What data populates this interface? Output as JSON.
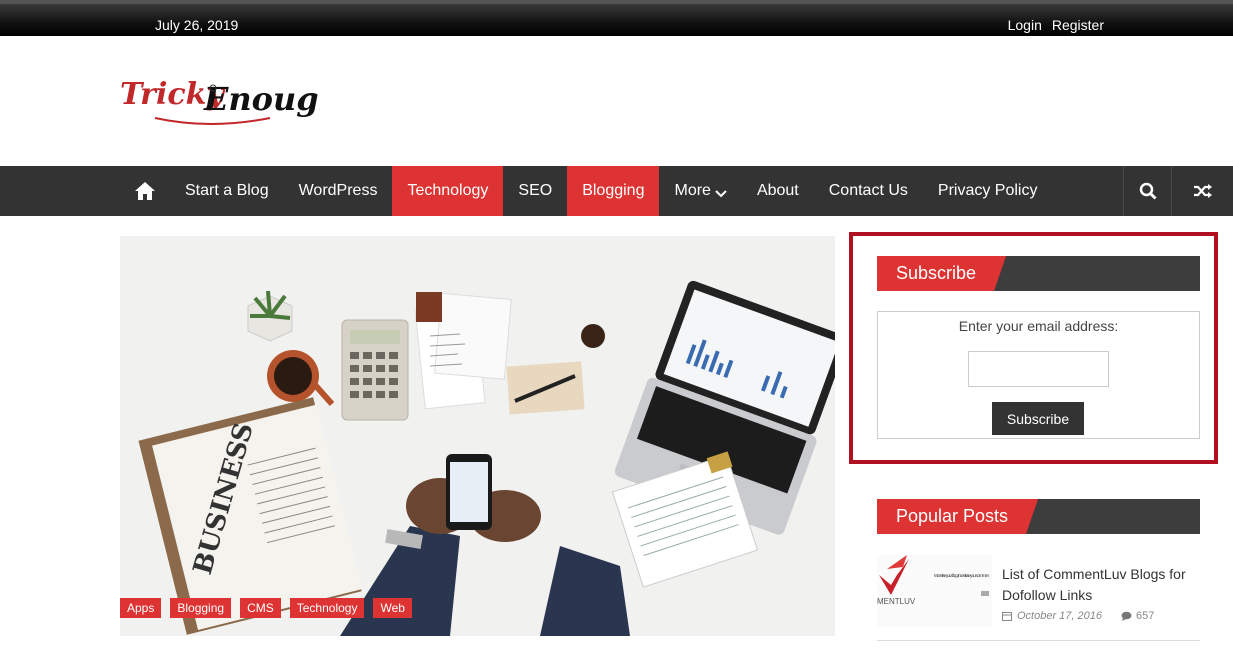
{
  "topbar": {
    "date": "July 26, 2019",
    "login": "Login",
    "register": "Register"
  },
  "logo": {
    "part1": "Tricky",
    "part2": "Enough"
  },
  "nav": {
    "items": [
      {
        "label": "Start a Blog",
        "active": false
      },
      {
        "label": "WordPress",
        "active": false
      },
      {
        "label": "Technology",
        "active": true
      },
      {
        "label": "SEO",
        "active": false
      },
      {
        "label": "Blogging",
        "active": true
      },
      {
        "label": "More",
        "active": false
      },
      {
        "label": "About",
        "active": false
      },
      {
        "label": "Contact Us",
        "active": false
      },
      {
        "label": "Privacy Policy",
        "active": false
      }
    ],
    "icons": [
      "home-icon",
      "chevron-down-icon",
      "search-icon",
      "shuffle-icon"
    ]
  },
  "hero": {
    "tags": [
      "Apps",
      "Blogging",
      "CMS",
      "Technology",
      "Web"
    ],
    "newspaper": "BUSINESS"
  },
  "subscribe": {
    "heading": "Subscribe",
    "prompt": "Enter your email address:",
    "email_value": "",
    "button": "Subscribe"
  },
  "popular": {
    "heading": "Popular Posts",
    "posts": [
      {
        "title": "List of CommentLuv Blogs for Dofollow Links",
        "date": "October 17, 2016",
        "comments": "657",
        "thumb_text1": "MENTLUV",
        "thumb_text2": "Monetise your blog. Incentivise your commen"
      }
    ]
  },
  "colors": {
    "accent": "#dd3333",
    "nav_bg": "#333333",
    "highlight_border": "#b01020"
  }
}
